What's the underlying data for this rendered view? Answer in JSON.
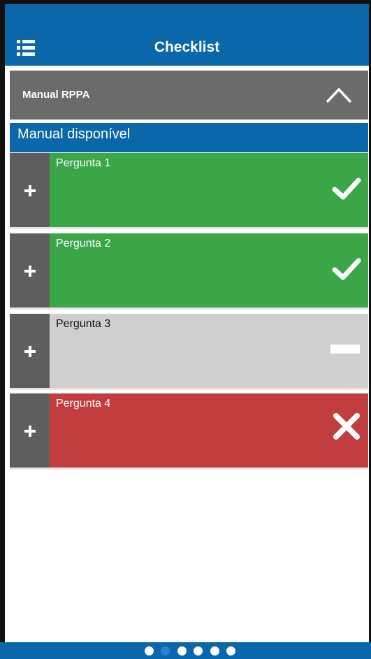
{
  "header": {
    "title": "Checklist",
    "menu_icon": "list-menu-icon"
  },
  "section": {
    "title": "Manual RPPA",
    "toggle_icon": "chevron-up-icon"
  },
  "subheader": {
    "text": "Manual disponível"
  },
  "questions": [
    {
      "label": "Pergunta 1",
      "status": "correct",
      "status_icon": "check-icon",
      "color": "#3aa647"
    },
    {
      "label": "Pergunta 2",
      "status": "correct",
      "status_icon": "check-icon",
      "color": "#3aa647"
    },
    {
      "label": "Pergunta 3",
      "status": "not-answered",
      "status_icon": "minus-icon",
      "color": "#cfcfcf"
    },
    {
      "label": "Pergunta 4",
      "status": "wrong",
      "status_icon": "close-icon",
      "color": "#c23e3e"
    }
  ],
  "pagination": {
    "total": 6,
    "active": 2
  },
  "colors": {
    "primary": "#0a67a9",
    "section_bg": "#6b6b6b",
    "expand_bg": "#5e5e5e",
    "dot_active": "#2d7fd0"
  }
}
